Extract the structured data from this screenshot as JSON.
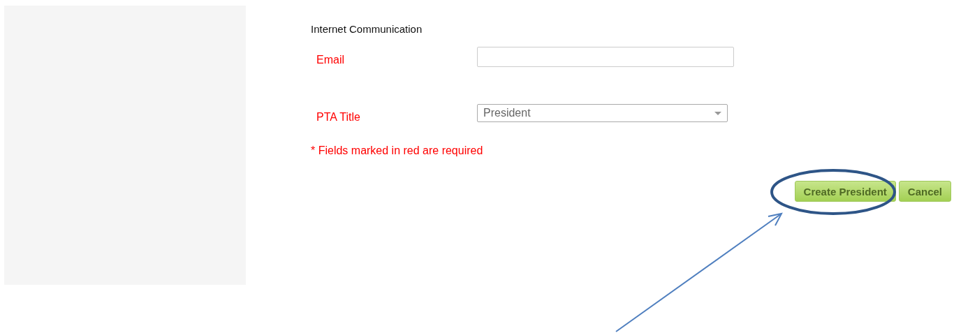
{
  "section_title": "Internet Communication",
  "fields": [
    {
      "kind": "text",
      "label": "Email",
      "required": true
    },
    {
      "kind": "select",
      "label": "PTA Title",
      "required": true,
      "value": "President"
    }
  ],
  "required_note": "* Fields marked in red are required",
  "buttons": [
    "Create President",
    "Cancel"
  ]
}
